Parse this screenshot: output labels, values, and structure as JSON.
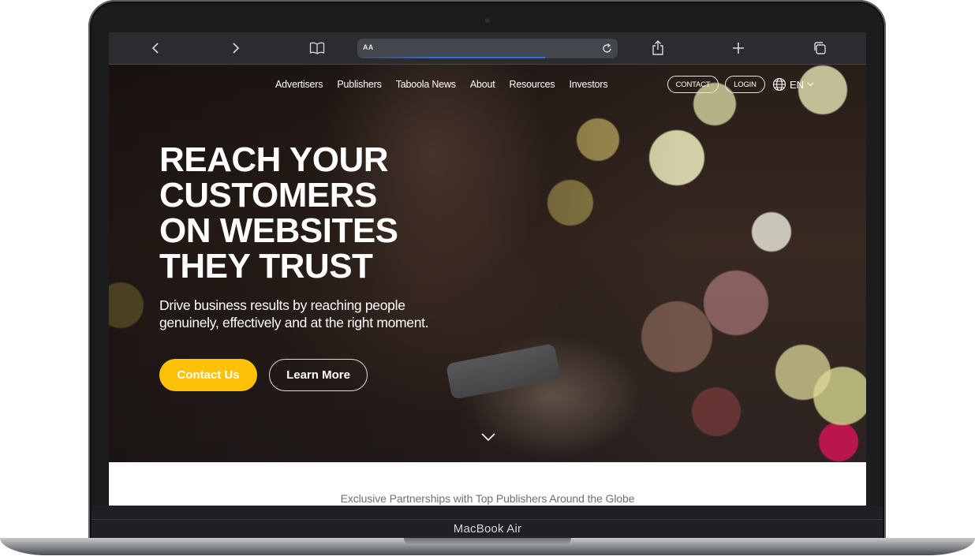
{
  "device": {
    "label": "MacBook Air"
  },
  "browser": {
    "address_text": "AA",
    "load_progress": 0.72,
    "icons": {
      "back": "chevron-left-icon",
      "forward": "chevron-right-icon",
      "bookmarks": "book-icon",
      "reload": "reload-icon",
      "share": "share-icon",
      "new_tab": "plus-icon",
      "tabs": "tabs-icon"
    }
  },
  "nav": {
    "links": [
      "Advertisers",
      "Publishers",
      "Taboola News",
      "About",
      "Resources",
      "Investors"
    ],
    "contact_label": "CONTACT",
    "login_label": "LOGIN",
    "language": "EN"
  },
  "hero": {
    "headline": [
      "REACH YOUR",
      "CUSTOMERS",
      "ON WEBSITES",
      "THEY TRUST"
    ],
    "subtitle_lines": [
      "Drive business results by reaching people",
      "genuinely, effectively and at the right moment."
    ],
    "primary_cta": "Contact Us",
    "secondary_cta": "Learn More"
  },
  "partners": {
    "text": "Exclusive Partnerships with Top Publishers Around the Globe"
  },
  "colors": {
    "accent": "#ffc107",
    "toolbar": "#2a2c30",
    "progress": "#2d6fe0"
  }
}
